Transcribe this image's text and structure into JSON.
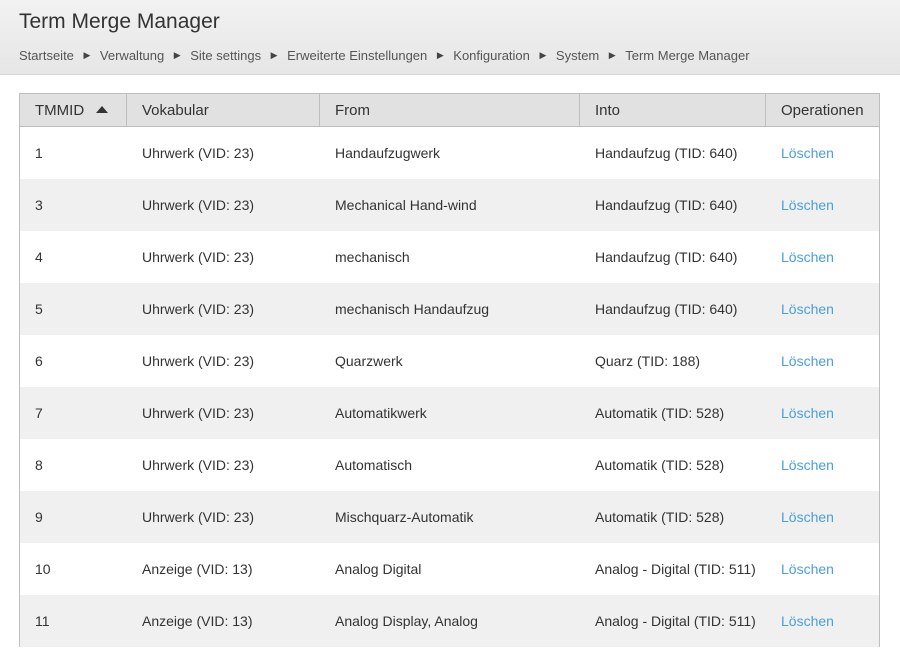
{
  "header": {
    "title": "Term Merge Manager",
    "breadcrumb": [
      "Startseite",
      "Verwaltung",
      "Site settings",
      "Erweiterte Einstellungen",
      "Konfiguration",
      "System",
      "Term Merge Manager"
    ],
    "separator_icon": "triangle-right-icon"
  },
  "table": {
    "columns": [
      "TMMID",
      "Vokabular",
      "From",
      "Into",
      "Operationen"
    ],
    "sorted_column": "TMMID",
    "sort_direction": "ascending",
    "rows": [
      {
        "tmmid": "1",
        "vokabular": "Uhrwerk (VID: 23)",
        "from": "Handaufzugwerk",
        "into": "Handaufzug (TID: 640)",
        "op": "Löschen"
      },
      {
        "tmmid": "3",
        "vokabular": "Uhrwerk (VID: 23)",
        "from": "Mechanical Hand-wind",
        "into": "Handaufzug (TID: 640)",
        "op": "Löschen"
      },
      {
        "tmmid": "4",
        "vokabular": "Uhrwerk (VID: 23)",
        "from": "mechanisch",
        "into": "Handaufzug (TID: 640)",
        "op": "Löschen"
      },
      {
        "tmmid": "5",
        "vokabular": "Uhrwerk (VID: 23)",
        "from": "mechanisch Handaufzug",
        "into": "Handaufzug (TID: 640)",
        "op": "Löschen"
      },
      {
        "tmmid": "6",
        "vokabular": "Uhrwerk (VID: 23)",
        "from": "Quarzwerk",
        "into": "Quarz (TID: 188)",
        "op": "Löschen"
      },
      {
        "tmmid": "7",
        "vokabular": "Uhrwerk (VID: 23)",
        "from": "Automatikwerk",
        "into": "Automatik (TID: 528)",
        "op": "Löschen"
      },
      {
        "tmmid": "8",
        "vokabular": "Uhrwerk (VID: 23)",
        "from": "Automatisch",
        "into": "Automatik (TID: 528)",
        "op": "Löschen"
      },
      {
        "tmmid": "9",
        "vokabular": "Uhrwerk (VID: 23)",
        "from": "Mischquarz-Automatik",
        "into": "Automatik (TID: 528)",
        "op": "Löschen"
      },
      {
        "tmmid": "10",
        "vokabular": "Anzeige (VID: 13)",
        "from": "Analog Digital",
        "into": "Analog - Digital (TID: 511)",
        "op": "Löschen"
      },
      {
        "tmmid": "11",
        "vokabular": "Anzeige (VID: 13)",
        "from": "Analog Display, Analog",
        "into": "Analog - Digital (TID: 511)",
        "op": "Löschen"
      }
    ]
  },
  "colors": {
    "link": "#4a9fd8",
    "header_bg": "#e1e1e1",
    "row_alt_bg": "#f0f0f0"
  }
}
